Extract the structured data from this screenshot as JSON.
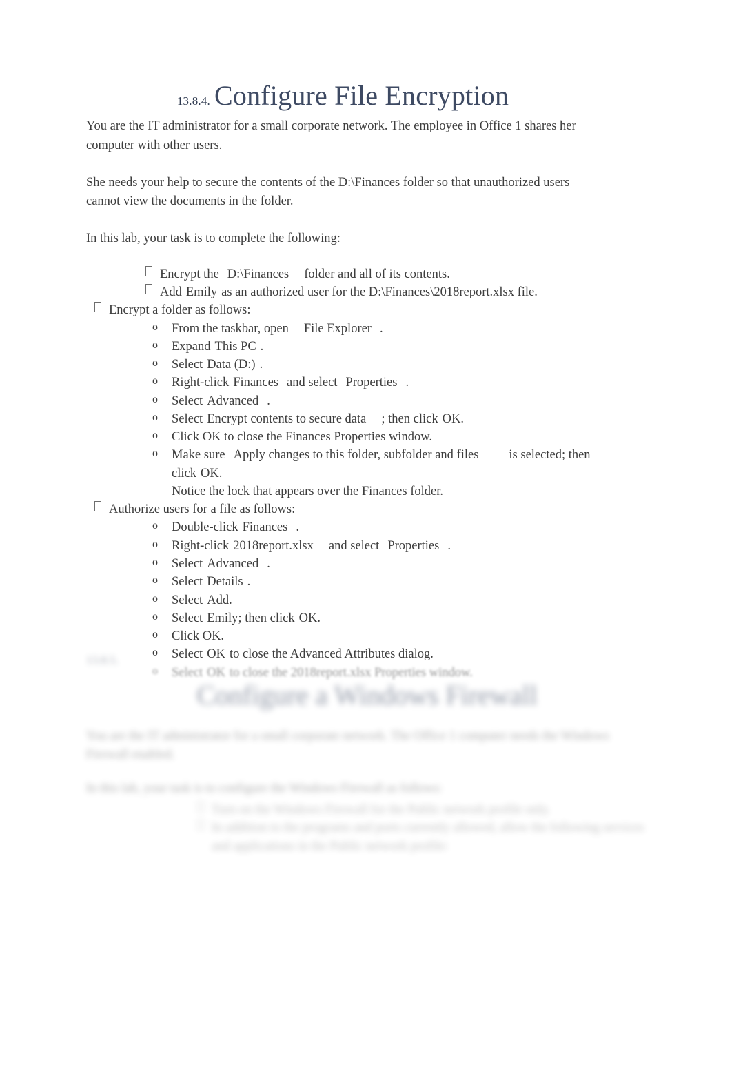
{
  "document": {
    "background_color": "#ffffff",
    "heading_color": "#3e4a63",
    "body_color": "#3d3d3d"
  },
  "section": {
    "number": "13.8.4.",
    "title": "Configure File Encryption"
  },
  "intro": {
    "paragraph_1": "You are the IT administrator for a small corporate network. The employee in Office 1 shares her computer with other users.",
    "paragraph_2": "She needs your help to secure the contents of the D:\\Finances folder so that unauthorized users cannot view the documents in the folder.",
    "paragraph_3": "In this lab, your task is to complete the following:"
  },
  "bullets": {
    "marker_level_a": "missing-glyph-box",
    "marker_level_b": "missing-glyph-box",
    "marker_level_c": "o",
    "tasks": [
      {
        "prefix": "Encrypt the",
        "keyword": "D:\\Finances",
        "suffix": "folder and all of its contents."
      },
      {
        "prefix": "Add",
        "keyword": "Emily",
        "suffix": "as an authorized user for the D:\\Finances\\2018report.xlsx file."
      }
    ]
  },
  "procedures": [
    {
      "heading": "Encrypt a folder as follows:",
      "steps": [
        {
          "prefix": "From the taskbar, open",
          "keyword": "File Explorer",
          "suffix": "."
        },
        {
          "prefix": "Expand",
          "keyword": "This PC",
          "suffix": "."
        },
        {
          "prefix": "Select",
          "keyword": "Data (D:)",
          "suffix": "."
        },
        {
          "prefix": "Right-click",
          "keyword": "Finances",
          "mid": "and select",
          "keyword2": "Properties",
          "suffix": "."
        },
        {
          "prefix": "Select",
          "keyword": "Advanced",
          "suffix": "."
        },
        {
          "prefix": "Select",
          "keyword": "Encrypt contents to secure data",
          "suffix": "; then click",
          "keyword2": "OK",
          "tail": "."
        },
        {
          "prefix": "Click OK to close the Finances Properties window.",
          "keyword": "",
          "suffix": ""
        },
        {
          "prefix": "Make sure",
          "keyword": "Apply changes to this folder, subfolder and files",
          "suffix": "is selected; then click",
          "keyword2": "OK",
          "tail": ".",
          "continuation": "Notice the lock that appears over the Finances folder."
        }
      ]
    },
    {
      "heading": "Authorize users for a file as follows:",
      "steps": [
        {
          "prefix": "Double-click",
          "keyword": "Finances",
          "suffix": "."
        },
        {
          "prefix": "Right-click",
          "keyword": "2018report.xlsx",
          "mid": "and select",
          "keyword2": "Properties",
          "suffix": "."
        },
        {
          "prefix": "Select",
          "keyword": "Advanced",
          "suffix": "."
        },
        {
          "prefix": "Select",
          "keyword": "Details",
          "suffix": "."
        },
        {
          "prefix": "Select",
          "keyword": "Add",
          "suffix": "."
        },
        {
          "prefix": "Select",
          "keyword": "Emily",
          "suffix": "; then click",
          "keyword2": "OK",
          "tail": "."
        },
        {
          "prefix": "Click OK.",
          "keyword": "",
          "suffix": ""
        },
        {
          "prefix": "Select",
          "keyword": "OK",
          "suffix": "to close the Advanced Attributes dialog."
        },
        {
          "prefix": "Select",
          "keyword": "OK",
          "suffix": "to close the 2018report.xlsx Properties window.",
          "faded": true
        }
      ]
    }
  ],
  "next_section": {
    "number": "13.8.5.",
    "title": "Configure a Windows Firewall",
    "paragraph_1": "You are the IT administrator for a small corporate network. The Office 1 computer needs the Windows Firewall enabled.",
    "paragraph_2": "In this lab, your task is to configure the Windows Firewall as follows:",
    "bullets": [
      "Turn on the Windows Firewall for the Public network profile only.",
      "In addition to the programs and ports currently allowed, allow the following services and applications in the Public network profile:"
    ],
    "rendering": "blurred"
  }
}
